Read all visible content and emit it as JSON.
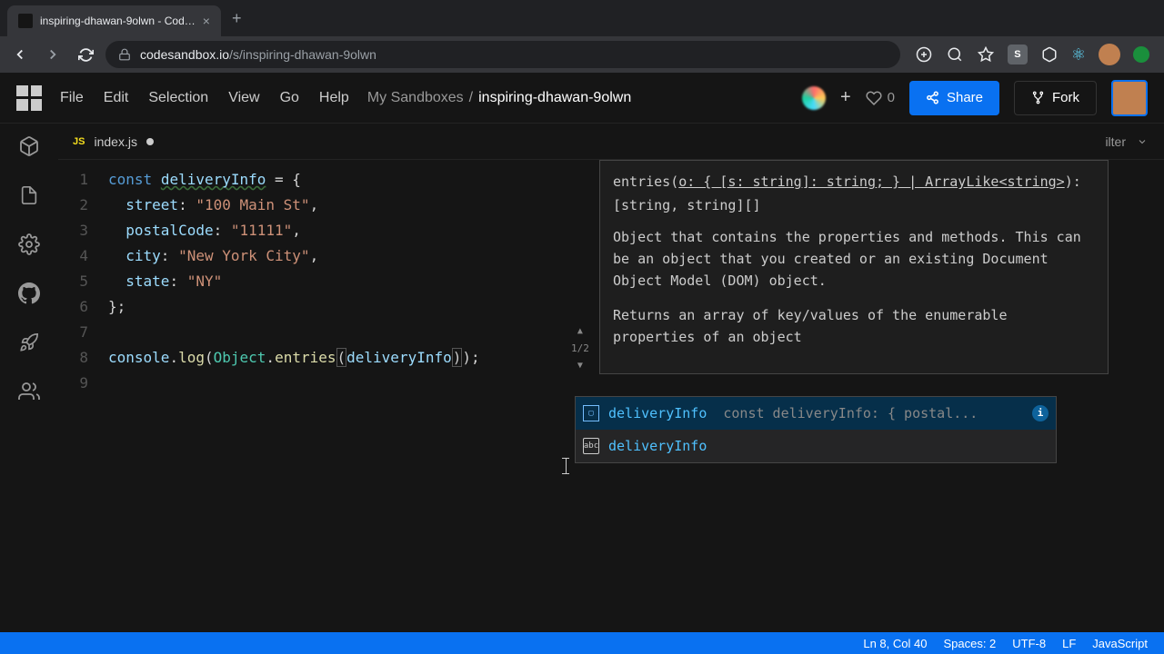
{
  "browser": {
    "tab_title": "inspiring-dhawan-9olwn - Cod…",
    "url_prefix": "codesandbox.io",
    "url_path": "/s/inspiring-dhawan-9olwn"
  },
  "menu": [
    "File",
    "Edit",
    "Selection",
    "View",
    "Go",
    "Help"
  ],
  "breadcrumb": {
    "parent": "My Sandboxes",
    "sep": "/",
    "current": "inspiring-dhawan-9olwn"
  },
  "likes": "0",
  "buttons": {
    "share": "Share",
    "fork": "Fork"
  },
  "tab": {
    "lang": "JS",
    "name": "index.js"
  },
  "filter_label": "ilter",
  "code": {
    "l1_kw": "const",
    "l1_var": "deliveryInfo",
    "l1_rest": " = {",
    "l2_prop": "street",
    "l2_str": "\"100 Main St\"",
    "l3_prop": "postalCode",
    "l3_str": "\"11111\"",
    "l4_prop": "city",
    "l4_str": "\"New York City\"",
    "l5_prop": "state",
    "l5_str": "\"NY\"",
    "l6": "};",
    "l8_a": "console",
    "l8_b": "log",
    "l8_c": "Object",
    "l8_d": "entries",
    "l8_e": "deliveryInfo",
    "l8_f": ");"
  },
  "hover": {
    "sig_a": "entries(",
    "sig_b": "o: { [s: string]: string; } | ArrayLike<string>",
    "sig_c": "): [string, string][]",
    "desc1": "Object that contains the properties and methods. This can be an object that you created or an existing Document Object Model (DOM) object.",
    "desc2": "Returns an array of key/values of the enumerable properties of an object",
    "counter": "1/2"
  },
  "autocomplete": {
    "items": [
      {
        "name": "deliveryInfo",
        "detail": "const deliveryInfo: { postal..."
      },
      {
        "name": "deliveryInfo",
        "detail": ""
      }
    ]
  },
  "status": {
    "pos": "Ln 8, Col 40",
    "spaces": "Spaces: 2",
    "enc": "UTF-8",
    "eol": "LF",
    "lang": "JavaScript"
  }
}
